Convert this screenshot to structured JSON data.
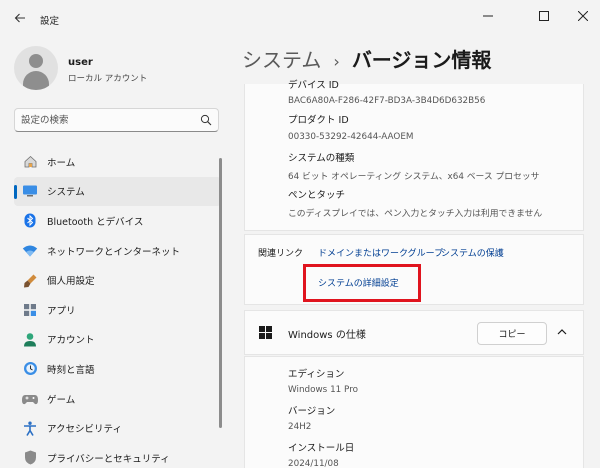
{
  "window": {
    "title": "設定",
    "back_icon": "arrow-left-icon",
    "minimize_icon": "minimize-icon",
    "maximize_icon": "maximize-icon",
    "close_icon": "close-icon"
  },
  "profile": {
    "name": "user",
    "account_type": "ローカル アカウント"
  },
  "search": {
    "placeholder": "設定の検索"
  },
  "sidebar": {
    "items": [
      {
        "label": "ホーム",
        "icon": "home-icon"
      },
      {
        "label": "システム",
        "icon": "system-display-icon",
        "active": true
      },
      {
        "label": "Bluetooth とデバイス",
        "icon": "bluetooth-icon"
      },
      {
        "label": "ネットワークとインターネット",
        "icon": "network-wifi-icon"
      },
      {
        "label": "個人用設定",
        "icon": "brush-icon"
      },
      {
        "label": "アプリ",
        "icon": "apps-icon"
      },
      {
        "label": "アカウント",
        "icon": "account-icon"
      },
      {
        "label": "時刻と言語",
        "icon": "time-language-icon"
      },
      {
        "label": "ゲーム",
        "icon": "gamepad-icon"
      },
      {
        "label": "アクセシビリティ",
        "icon": "accessibility-icon"
      },
      {
        "label": "プライバシーとセキュリティ",
        "icon": "shield-icon"
      }
    ]
  },
  "breadcrumb": {
    "parent": "システム",
    "separator": "›",
    "current": "バージョン情報"
  },
  "device_specs": {
    "device_id_label": "デバイス ID",
    "device_id_value": "BAC6A80A-F286-42F7-BD3A-3B4D6D632B56",
    "product_id_label": "プロダクト ID",
    "product_id_value": "00330-53292-42644-AAOEM",
    "system_type_label": "システムの種類",
    "system_type_value": "64 ビット オペレーティング システム、x64 ベース プロセッサ",
    "pen_touch_label": "ペンとタッチ",
    "pen_touch_value": "このディスプレイでは、ペン入力とタッチ入力は利用できません"
  },
  "related_links": {
    "title": "関連リンク",
    "domain": "ドメインまたはワークグループ",
    "protection": "システムの保護",
    "advanced": "システムの詳細設定"
  },
  "windows_spec": {
    "title": "Windows の仕様",
    "copy_label": "コピー",
    "edition_label": "エディション",
    "edition_value": "Windows 11 Pro",
    "version_label": "バージョン",
    "version_value": "24H2",
    "install_date_label": "インストール日",
    "install_date_value": "2024/11/08"
  },
  "colors": {
    "accent": "#0067c0",
    "link": "#003e92",
    "highlight_border": "#e0141e"
  }
}
